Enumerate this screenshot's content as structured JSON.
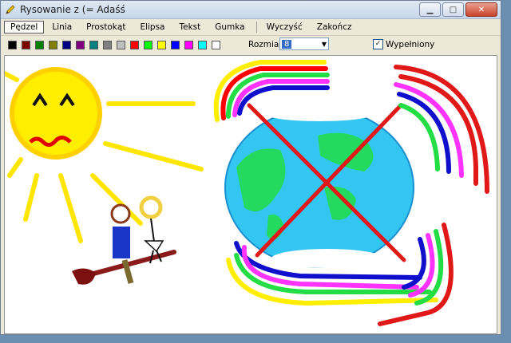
{
  "window": {
    "title": "Rysowanie z (= Adaśś"
  },
  "tools": [
    "Pędzel",
    "Linia",
    "Prostokąt",
    "Elipsa",
    "Tekst",
    "Gumka"
  ],
  "actions": [
    "Wyczyść",
    "Zakończ"
  ],
  "colors": [
    "#000000",
    "#800000",
    "#008000",
    "#808000",
    "#000080",
    "#800080",
    "#008080",
    "#808080",
    "#c0c0c0",
    "#ff0000",
    "#00ff00",
    "#ffff00",
    "#0000ff",
    "#ff00ff",
    "#00ffff",
    "#ffffff"
  ],
  "size": {
    "label": "Rozmiar:",
    "value": "8"
  },
  "fill": {
    "label": "Wypełniony",
    "checked": true
  }
}
